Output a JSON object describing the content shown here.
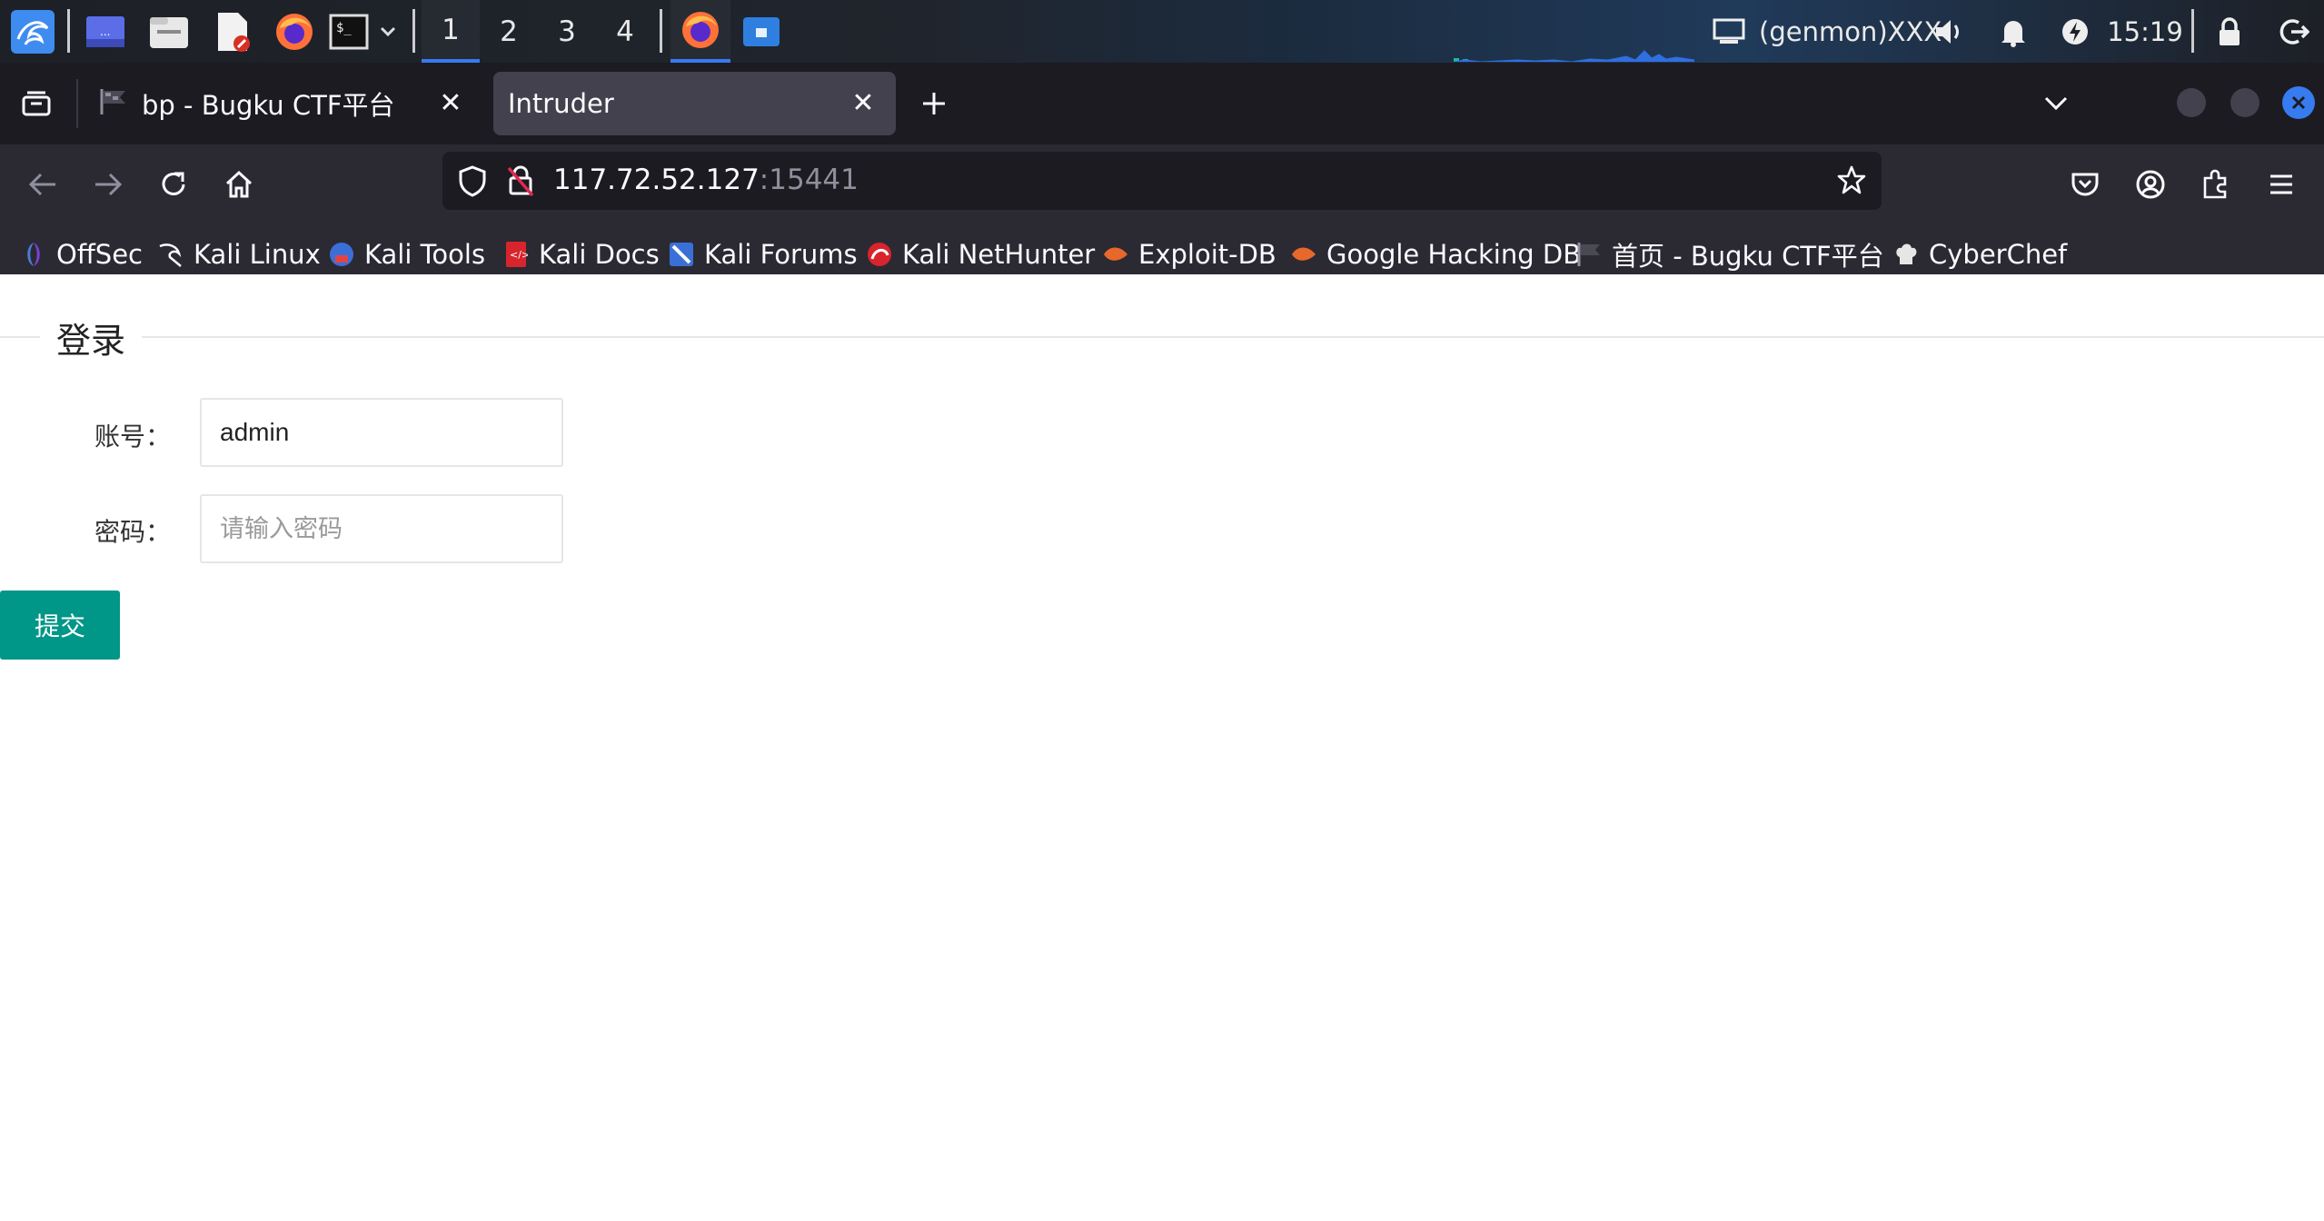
{
  "panel": {
    "workspaces": [
      "1",
      "2",
      "3",
      "4"
    ],
    "active_workspace": "1",
    "genmon_text": "(genmon)XXX",
    "clock": "15:19",
    "colors": {
      "accent": "#367bf0",
      "kali_blue": "#3b82f6"
    }
  },
  "browser": {
    "tabs": [
      {
        "title": "bp - Bugku CTF平台",
        "icon": "flag-icon",
        "active": false
      },
      {
        "title": "Intruder",
        "icon": "",
        "active": true
      }
    ],
    "url": {
      "host": "117.72.52.127",
      "port": ":15441"
    },
    "bookmarks": [
      {
        "label": "OffSec",
        "icon": "offsec-icon"
      },
      {
        "label": "Kali Linux",
        "icon": "kali-dragon-icon"
      },
      {
        "label": "Kali Tools",
        "icon": "kali-tools-icon"
      },
      {
        "label": "Kali Docs",
        "icon": "kali-docs-icon"
      },
      {
        "label": "Kali Forums",
        "icon": "kali-forums-icon"
      },
      {
        "label": "Kali NetHunter",
        "icon": "nethunter-icon"
      },
      {
        "label": "Exploit-DB",
        "icon": "exploitdb-icon"
      },
      {
        "label": "Google Hacking DB",
        "icon": "ghdb-icon"
      },
      {
        "label": "首页 - Bugku CTF平台",
        "icon": "flag-icon"
      },
      {
        "label": "CyberChef",
        "icon": "chef-hat-icon"
      }
    ]
  },
  "page": {
    "legend": "登录",
    "account_label": "账号：",
    "account_value": "admin",
    "password_label": "密码：",
    "password_placeholder": "请输入密码",
    "submit_label": "提交",
    "colors": {
      "submit_bg": "#009688"
    }
  }
}
